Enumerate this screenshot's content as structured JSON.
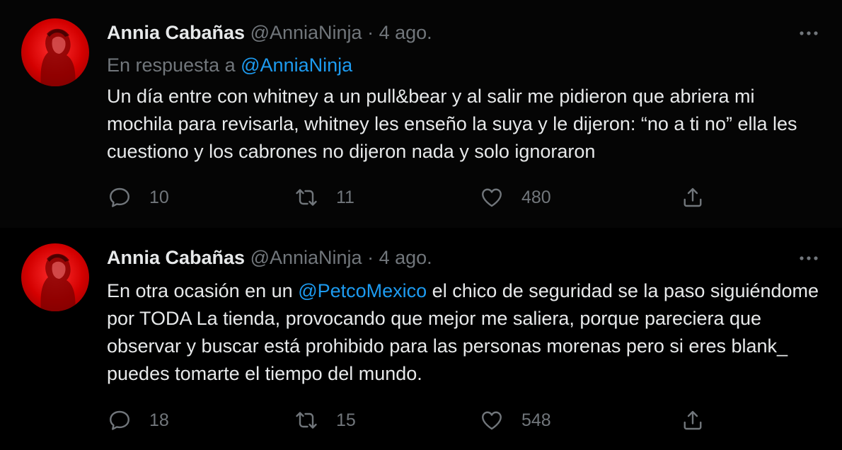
{
  "tweets": [
    {
      "author_name": "Annia Cabañas",
      "handle": "@AnniaNinja",
      "separator": "·",
      "date": "4 ago.",
      "reply_prefix": "En respuesta a",
      "reply_mention": "@AnniaNinja",
      "body": "Un día entre con whitney a un pull&bear y al salir me pidieron que abriera mi mochila para revisarla, whitney les enseño la suya y le dijeron: “no a ti no” ella les cuestiono y los cabrones no dijeron nada y solo ignoraron",
      "replies": "10",
      "retweets": "11",
      "likes": "480"
    },
    {
      "author_name": "Annia Cabañas",
      "handle": "@AnniaNinja",
      "separator": "·",
      "date": "4 ago.",
      "body_before": "En otra ocasión en un ",
      "body_mention": "@PetcoMexico",
      "body_after": " el chico de seguridad se la paso siguiéndome por TODA La tienda, provocando que mejor me saliera, porque pareciera que observar y buscar está prohibido para las personas morenas pero si eres blank_ puedes tomarte el tiempo del mundo.",
      "replies": "18",
      "retweets": "15",
      "likes": "548"
    }
  ],
  "icons": {
    "more": "more-horizontal-icon",
    "reply": "speech-bubble-icon",
    "retweet": "retweet-arrows-icon",
    "like": "heart-icon",
    "share": "share-upload-icon"
  },
  "colors": {
    "background": "#000000",
    "text": "#e7e9ea",
    "muted": "#71767b",
    "link": "#1d9bf0",
    "thread_line": "#3a3d41",
    "avatar_red": "#e00000"
  }
}
